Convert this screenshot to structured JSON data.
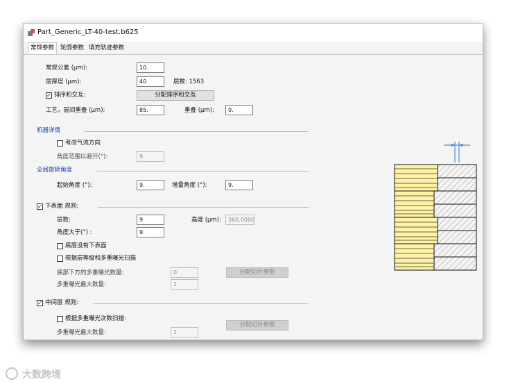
{
  "window": {
    "title": "Part_Generic_LT-40-test.b625"
  },
  "tabs": [
    {
      "label": "常规参数"
    },
    {
      "label": "轮廓参数"
    },
    {
      "label": "填充轨迹参数"
    }
  ],
  "general": {
    "tolerance_label": "常规公差 (µm):",
    "tolerance_value": "10.",
    "layer_thickness_label": "层厚度 (µm):",
    "layer_thickness_value": "40",
    "layer_count_label": "层数: 1563",
    "sort_label": "排序和交互:",
    "sort_checked": "✓",
    "assign_sort_button": "分配排序和交互",
    "process_overlap_label": "工艺，层间重叠 (µm):",
    "process_overlap_value": "85.",
    "overlap_label": "重叠 (µm):",
    "overlap_value": "0."
  },
  "machine": {
    "heading": "机器详情",
    "gas_flow_label": "考虑气流方向",
    "angle_range_label": "角度范围以避开(°):",
    "angle_range_value": "9."
  },
  "rotation": {
    "heading": "全局旋转角度",
    "start_angle_label": "起始角度 (°):",
    "start_angle_value": "9.",
    "increment_label": "增量角度 (°):",
    "increment_value": "9."
  },
  "downskin": {
    "heading": "下表面 规则:",
    "checked": "✓",
    "layers_label": "层数:",
    "layers_value": "9",
    "height_label": "高度 (µm):",
    "height_value": "360.0000",
    "angle_label": "角度大于(°) :",
    "angle_value": "9.",
    "no_bottom_label": "底层没有下表面",
    "multi_scan_label": "根据层等级和多重曝光扫描",
    "bottom_exposure_label": "底部下方的多重曝光数量:",
    "bottom_exposure_value": "0",
    "max_exposure_label": "多重曝光最大数量:",
    "max_exposure_value": "1",
    "assign_slice_button": "分配切片参数"
  },
  "middle": {
    "heading": "中间层 规则:",
    "checked": "✓",
    "multi_scan_label": "根据多重曝光次数扫描:",
    "max_exposure_label": "多重曝光最大数量:",
    "max_exposure_value": "1",
    "assign_slice_button": "分配切片参数"
  },
  "watermark": {
    "text": "大数跨境"
  },
  "colors": {
    "section_heading": "#1f3fa6",
    "fill_stripe": "#fff2a6",
    "hatch": "#999999",
    "dimension": "#2a7fd4"
  }
}
